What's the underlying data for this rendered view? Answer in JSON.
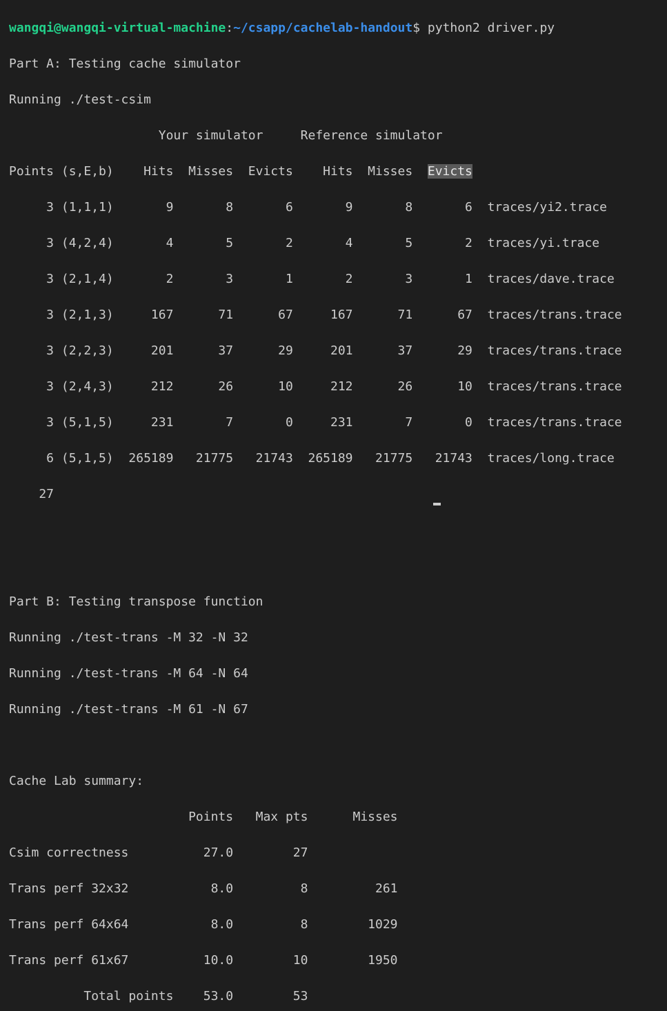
{
  "prompt": {
    "user_host": "wangqi@wangqi-virtual-machine",
    "separator": ":",
    "path": "~/csapp/cachelab-handout",
    "symbol": "$",
    "command": " python2 driver.py"
  },
  "part_a": {
    "title": "Part A: Testing cache simulator",
    "running": "Running ./test-csim",
    "group_header": "                    Your simulator     Reference simulator",
    "column_header_pre": "Points (s,E,b)    Hits  Misses  Evicts    Hits  Misses  ",
    "column_header_highlight": "Evicts",
    "rows": [
      "     3 (1,1,1)       9       8       6       9       8       6  traces/yi2.trace",
      "     3 (4,2,4)       4       5       2       4       5       2  traces/yi.trace",
      "     3 (2,1,4)       2       3       1       2       3       1  traces/dave.trace",
      "     3 (2,1,3)     167      71      67     167      71      67  traces/trans.trace",
      "     3 (2,2,3)     201      37      29     201      37      29  traces/trans.trace",
      "     3 (2,4,3)     212      26      10     212      26      10  traces/trans.trace",
      "     3 (5,1,5)     231       7       0     231       7       0  traces/trans.trace",
      "     6 (5,1,5)  265189   21775   21743  265189   21775   21743  traces/long.trace"
    ],
    "total": "    27"
  },
  "part_b": {
    "title": "Part B: Testing transpose function",
    "runs": [
      "Running ./test-trans -M 32 -N 32",
      "Running ./test-trans -M 64 -N 64",
      "Running ./test-trans -M 61 -N 67"
    ]
  },
  "summary": {
    "title": "Cache Lab summary:",
    "header": "                        Points   Max pts      Misses",
    "rows": [
      "Csim correctness          27.0        27",
      "Trans perf 32x32           8.0         8         261",
      "Trans perf 64x64           8.0         8        1029",
      "Trans perf 61x67          10.0        10        1950",
      "          Total points    53.0        53"
    ]
  }
}
